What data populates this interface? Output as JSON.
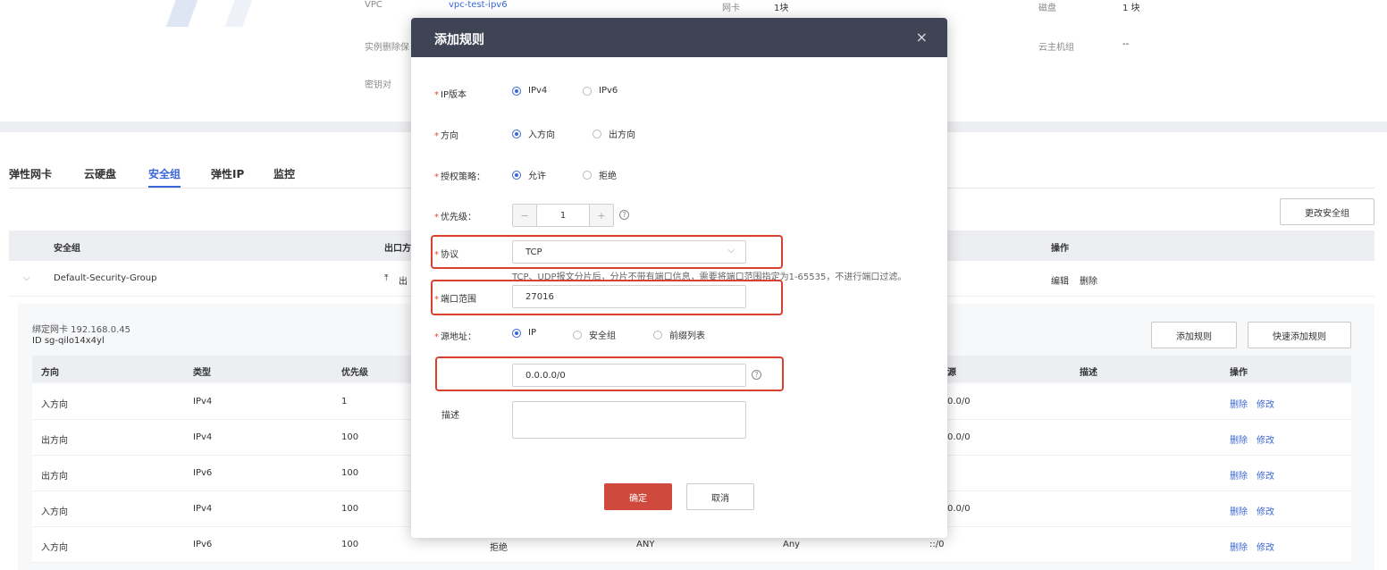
{
  "top_info": {
    "vpc_label": "VPC",
    "vpc_value": "vpc-test-ipv6",
    "nic_label": "网卡",
    "nic_value": "1块",
    "disk_label": "磁盘",
    "disk_value": "1 块",
    "delete_protect_label": "实例删除保",
    "vm_group_label": "云主机组",
    "vm_group_value": "--",
    "keypair_label": "密钥对"
  },
  "tabs": [
    "弹性网卡",
    "云硬盘",
    "安全组",
    "弹性IP",
    "监控"
  ],
  "active_tab": "安全组",
  "change_sg_button": "更改安全组",
  "sg_table": {
    "headers": {
      "name": "安全组",
      "out": "出口方",
      "ops": "操作"
    },
    "row": {
      "name": "Default-Security-Group",
      "out": "出",
      "edit": "编辑",
      "delete": "删除"
    }
  },
  "bound_nic": "绑定网卡 192.168.0.45",
  "sg_id": "ID sg-qilo14x4yl",
  "add_rule_button": "添加规则",
  "quick_add_button": "快速添加规则",
  "rules_table": {
    "headers": {
      "direction": "方向",
      "type": "类型",
      "priority": "优先级",
      "source": "源",
      "desc": "描述",
      "ops": "操作"
    },
    "rows": [
      {
        "direction": "入方向",
        "type": "IPv4",
        "priority": "1",
        "policy": "",
        "protocol": "",
        "port": "",
        "source": "0.0/0",
        "delete": "删除",
        "modify": "修改"
      },
      {
        "direction": "出方向",
        "type": "IPv4",
        "priority": "100",
        "policy": "",
        "protocol": "",
        "port": "",
        "source": "0.0/0",
        "delete": "删除",
        "modify": "修改"
      },
      {
        "direction": "出方向",
        "type": "IPv6",
        "priority": "100",
        "policy": "",
        "protocol": "",
        "port": "",
        "source": "",
        "delete": "删除",
        "modify": "修改"
      },
      {
        "direction": "入方向",
        "type": "IPv4",
        "priority": "100",
        "policy": "",
        "protocol": "",
        "port": "",
        "source": "0.0/0",
        "delete": "删除",
        "modify": "修改"
      },
      {
        "direction": "入方向",
        "type": "IPv6",
        "priority": "100",
        "policy": "拒绝",
        "protocol": "ANY",
        "port": "Any",
        "source": "::/0",
        "delete": "删除",
        "modify": "修改"
      }
    ]
  },
  "modal": {
    "title": "添加规则",
    "close": "×",
    "ip_version": {
      "label": "IP版本",
      "options": [
        "IPv4",
        "IPv6"
      ],
      "selected": "IPv4"
    },
    "direction": {
      "label": "方向",
      "options": [
        "入方向",
        "出方向"
      ],
      "selected": "入方向"
    },
    "policy": {
      "label": "授权策略：",
      "options": [
        "允许",
        "拒绝"
      ],
      "selected": "允许"
    },
    "priority": {
      "label": "优先级：",
      "value": "1",
      "minus": "−",
      "plus": "+"
    },
    "protocol": {
      "label": "协议",
      "value": "TCP"
    },
    "protocol_hint": "TCP、UDP报文分片后，分片不带有端口信息，需要将端口范围指定为1-65535，不进行端口过滤。",
    "port_range": {
      "label": "端口范围",
      "value": "27016"
    },
    "source": {
      "label": "源地址：",
      "options": [
        "IP",
        "安全组",
        "前缀列表"
      ],
      "selected": "IP"
    },
    "source_ip": "0.0.0.0/0",
    "desc_label": "描述",
    "confirm": "确定",
    "cancel": "取消"
  },
  "colors": {
    "accent": "#3b66d8",
    "primary_button": "#d0493d",
    "highlight": "#d9412f",
    "modal_header": "#3f4455"
  }
}
